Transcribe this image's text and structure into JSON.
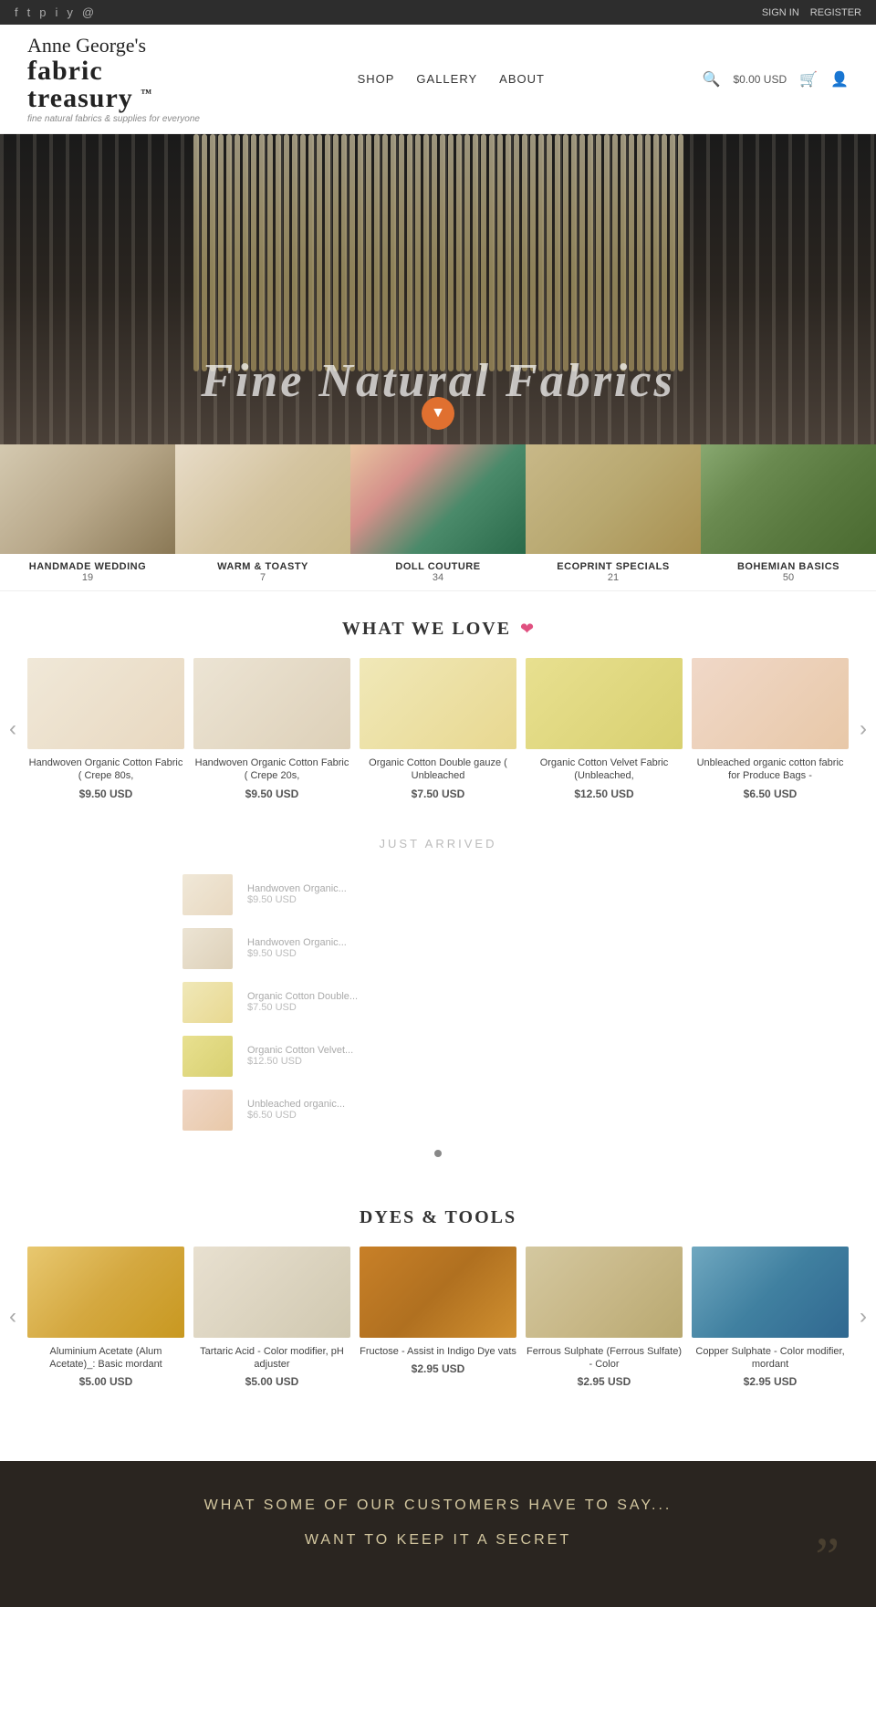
{
  "topbar": {
    "social_icons": [
      "facebook",
      "twitter",
      "pinterest",
      "instagram",
      "youtube",
      "email"
    ],
    "auth": {
      "signin": "SIGN IN",
      "register": "REGISTER"
    }
  },
  "header": {
    "logo_script": "Anne George's",
    "logo_bold": "fabric",
    "logo_bold2": "treasury",
    "logo_tm": "™",
    "logo_tagline": "fine natural fabrics & supplies for everyone",
    "nav": [
      {
        "label": "SHOP",
        "href": "#"
      },
      {
        "label": "GALLERY",
        "href": "#"
      },
      {
        "label": "ABOUT",
        "href": "#"
      }
    ],
    "cart_amount": "$0.00 USD"
  },
  "hero": {
    "title": "Fine Natural Fabrics",
    "scroll_icon": "▼"
  },
  "collections": [
    {
      "name": "HANDMADE WEDDING",
      "count": "19",
      "style": "col-handmade"
    },
    {
      "name": "WARM & TOASTY",
      "count": "7",
      "style": "col-warmtoasty"
    },
    {
      "name": "DOLL COUTURE",
      "count": "34",
      "style": "col-dollcouture"
    },
    {
      "name": "ECOPRINT SPECIALS",
      "count": "21",
      "style": "col-ecoprint"
    },
    {
      "name": "BOHEMIAN BASICS",
      "count": "50",
      "style": "col-bohemian"
    }
  ],
  "what_we_love": {
    "title": "WHAT WE LOVE",
    "products": [
      {
        "name": "Handwoven Organic Cotton Fabric ( Crepe 80s,",
        "price": "$9.50 USD",
        "style": "prod-cream1"
      },
      {
        "name": "Handwoven Organic Cotton Fabric ( Crepe 20s,",
        "price": "$9.50 USD",
        "style": "prod-cream2"
      },
      {
        "name": "Organic Cotton Double gauze ( Unbleached",
        "price": "$7.50 USD",
        "style": "prod-yellow"
      },
      {
        "name": "Organic Cotton Velvet Fabric (Unbleached,",
        "price": "$12.50 USD",
        "style": "prod-yellow2"
      },
      {
        "name": "Unbleached organic cotton fabric for Produce Bags -",
        "price": "$6.50 USD",
        "style": "prod-peach"
      }
    ]
  },
  "just_arrived": {
    "title": "JUST ARRIVED",
    "items": [
      {
        "name": "Handwoven Organic...",
        "price": "$9.50 USD",
        "style": "prod-cream1"
      },
      {
        "name": "Handwoven Organic...",
        "price": "$9.50 USD",
        "style": "prod-cream2"
      },
      {
        "name": "Organic Cotton Double...",
        "price": "$7.50 USD",
        "style": "prod-yellow"
      },
      {
        "name": "Organic Cotton Velvet...",
        "price": "$12.50 USD",
        "style": "prod-yellow2"
      },
      {
        "name": "Unbleached organic...",
        "price": "$6.50 USD",
        "style": "prod-peach"
      }
    ]
  },
  "dyes_tools": {
    "title": "DYES & TOOLS",
    "products": [
      {
        "name": "Aluminium Acetate (Alum Acetate)_: Basic mordant",
        "price": "$5.00 USD",
        "style": "dye-alum"
      },
      {
        "name": "Tartaric Acid - Color modifier, pH adjuster",
        "price": "$5.00 USD",
        "style": "dye-tartaric"
      },
      {
        "name": "Fructose - Assist in Indigo Dye vats",
        "price": "$2.95 USD",
        "style": "dye-fructose"
      },
      {
        "name": "Ferrous Sulphate (Ferrous Sulfate) - Color",
        "price": "$2.95 USD",
        "style": "dye-ferrous"
      },
      {
        "name": "Copper Sulphate - Color modifier, mordant",
        "price": "$2.95 USD",
        "style": "dye-copper"
      }
    ]
  },
  "testimonials": {
    "title": "WHAT SOME OF OUR CUSTOMERS HAVE TO SAY...",
    "secret": "WANT TO KEEP IT A SECRET"
  }
}
